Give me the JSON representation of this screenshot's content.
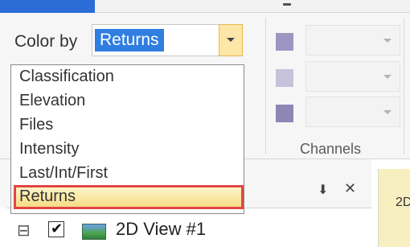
{
  "color_by": {
    "label": "Color by",
    "selected": "Returns",
    "options": [
      "Classification",
      "Elevation",
      "Files",
      "Intensity",
      "Last/Int/First",
      "Returns"
    ]
  },
  "ribbon": {
    "channels_label": "Channels"
  },
  "panel": {
    "pin_glyph": "⬇",
    "close_glyph": "✕",
    "tree_item_label": "2D View #1",
    "expander_glyph": "⊟",
    "checkbox_glyph": "✔",
    "right_tab_label": "2D"
  },
  "colors": {
    "selection_blue": "#2f7ee0",
    "highlight_border": "#e24545",
    "highlight_fill": "#f5dc83",
    "swatch_1": "#9f95c2",
    "swatch_2": "#c7c1db",
    "swatch_3": "#8e86b4"
  }
}
